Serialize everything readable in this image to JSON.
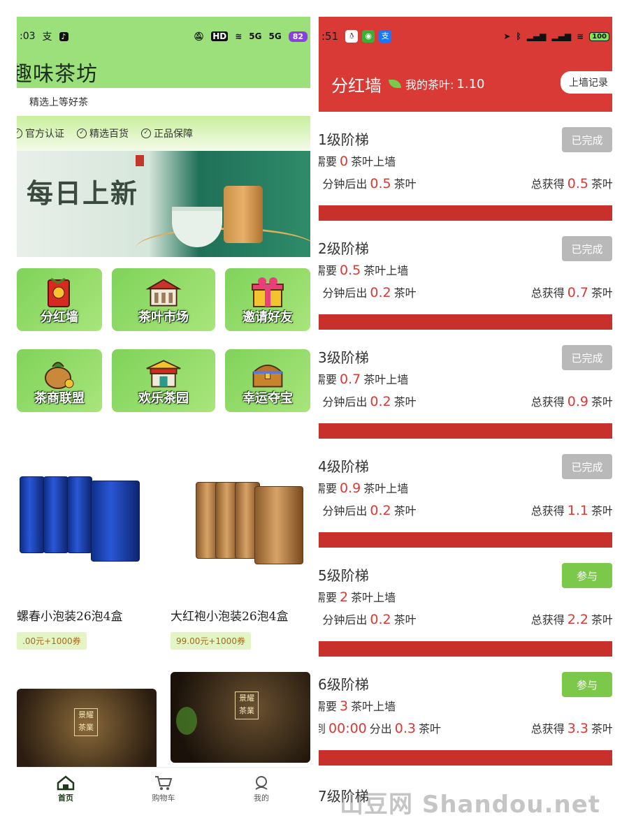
{
  "left": {
    "status": {
      "time": ":03",
      "battery": "82",
      "hd": "HD",
      "sig1": "5G",
      "sig2": "5G"
    },
    "app_title": "趣味茶坊",
    "slogan": "精选上等好茶",
    "badges": [
      "官方认证",
      "精选百货",
      "正品保障"
    ],
    "banner_text": "每日上新",
    "tiles": [
      {
        "label": "分红墙",
        "icon": "red-envelope-icon"
      },
      {
        "label": "茶叶市场",
        "icon": "market-building-icon"
      },
      {
        "label": "邀请好友",
        "icon": "gift-box-icon"
      },
      {
        "label": "茶商联盟",
        "icon": "money-bag-icon"
      },
      {
        "label": "欢乐茶园",
        "icon": "pavilion-icon"
      },
      {
        "label": "幸运夺宝",
        "icon": "treasure-chest-icon"
      }
    ],
    "products": [
      {
        "name": "螺春小泡装26泡4盒",
        "price": ".00元+1000券"
      },
      {
        "name": "大红袍小泡装26泡4盒",
        "price": "99.00元+1000券"
      }
    ],
    "photo_seal": "景耀茶業",
    "tabs": [
      {
        "label": "首页",
        "icon": "home-icon"
      },
      {
        "label": "购物车",
        "icon": "cart-icon"
      },
      {
        "label": "我的",
        "icon": "profile-icon"
      }
    ]
  },
  "right": {
    "status": {
      "time": ":51",
      "battery": "100"
    },
    "title": "分红墙",
    "my_leaves_label": "我的茶叶:",
    "my_leaves_value": "1.10",
    "record_button": "上墙记录",
    "need_prefix": "需要",
    "need_suffix": "茶叶上墙",
    "rate_mid": "分钟后出",
    "rate_suffix": "茶叶",
    "total_prefix": "总获得",
    "total_suffix": "茶叶",
    "levels": [
      {
        "name": "1级阶梯",
        "need": "0",
        "rate_prefix": ")",
        "minutes_out": "0.5",
        "total": "0.5",
        "button": "已完成",
        "state": "done"
      },
      {
        "name": "2级阶梯",
        "need": "0.5",
        "rate_prefix": ")",
        "minutes_out": "0.2",
        "total": "0.7",
        "button": "已完成",
        "state": "done"
      },
      {
        "name": "3级阶梯",
        "need": "0.7",
        "rate_prefix": ")",
        "minutes_out": "0.2",
        "total": "0.9",
        "button": "已完成",
        "state": "done"
      },
      {
        "name": "4级阶梯",
        "need": "0.9",
        "rate_prefix": ")",
        "minutes_out": "0.2",
        "total": "1.1",
        "button": "已完成",
        "state": "done"
      },
      {
        "name": "5级阶梯",
        "need": "2",
        "rate_prefix": ")",
        "minutes_out": "0.2",
        "total": "2.2",
        "button": "参与",
        "state": "join"
      },
      {
        "name": "6级阶梯",
        "need": "3",
        "rate_special": "到",
        "rate_time": "00:00",
        "rate_special_mid": "分出",
        "minutes_out": "0.3",
        "total": "3.3",
        "button": "参与",
        "state": "join"
      }
    ],
    "peek_level": "7级阶梯"
  },
  "watermark": "山豆网 Shandou.net"
}
